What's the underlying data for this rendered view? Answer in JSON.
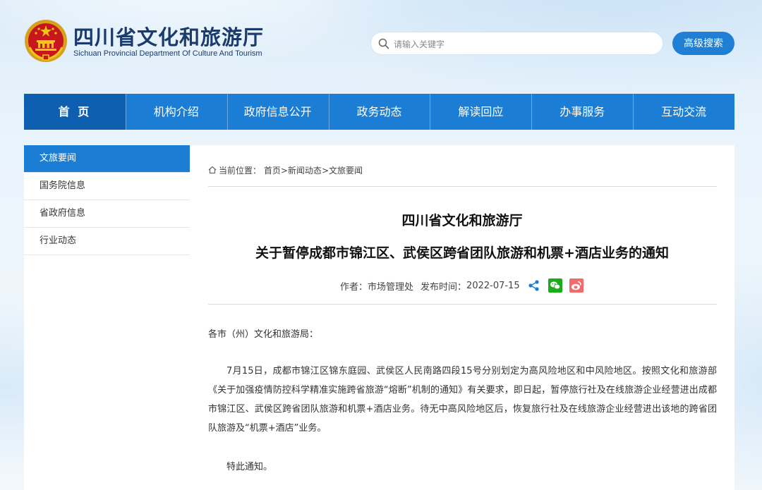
{
  "header": {
    "title": "四川省文化和旅游厅",
    "subtitle": "Sichuan Provincial Department Of Culture And Tourism",
    "search_placeholder": "请输入关键字",
    "advanced_search_label": "高级搜索"
  },
  "nav": {
    "items": [
      {
        "label": "首 页",
        "active": true
      },
      {
        "label": "机构介绍"
      },
      {
        "label": "政府信息公开"
      },
      {
        "label": "政务动态"
      },
      {
        "label": "解读回应"
      },
      {
        "label": "办事服务"
      },
      {
        "label": "互动交流"
      }
    ]
  },
  "sidebar": {
    "items": [
      {
        "label": "文旅要闻",
        "active": true
      },
      {
        "label": "国务院信息"
      },
      {
        "label": "省政府信息"
      },
      {
        "label": "行业动态"
      }
    ]
  },
  "breadcrumb": {
    "prefix": "当前位置：",
    "home": "首页",
    "sep": ">",
    "level1": "新闻动态",
    "level2": "文旅要闻"
  },
  "article": {
    "title_line1": "四川省文化和旅游厅",
    "title_line2": "关于暂停成都市锦江区、武侯区跨省团队旅游和机票+酒店业务的通知",
    "author_label": "作者：",
    "author": "市场管理处",
    "date_label": "发布时间：",
    "date": "2022-07-15",
    "greeting": "各市（州）文化和旅游局：",
    "paragraph": "7月15日，成都市锦江区锦东庭园、武侯区人民南路四段15号分别划定为高风险地区和中风险地区。按照文化和旅游部《关于加强疫情防控科学精准实施跨省旅游“熔断”机制的通知》有关要求，即日起，暂停旅行社及在线旅游企业经营进出成都市锦江区、武侯区跨省团队旅游和机票+酒店业务。待无中高风险地区后，恢复旅行社及在线旅游企业经营进出该地的跨省团队旅游及“机票+酒店”业务。",
    "closing": "特此通知。"
  },
  "colors": {
    "primary": "#1b7dd3",
    "primary_dark": "#0f5fb0",
    "title_navy": "#1a3b6b"
  }
}
